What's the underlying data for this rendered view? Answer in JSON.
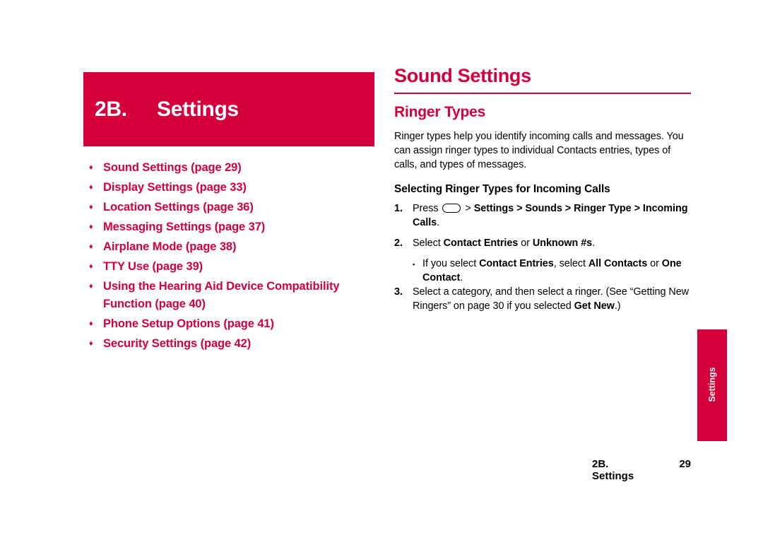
{
  "chapter": {
    "number": "2B.",
    "title": "Settings",
    "banner_color": "#d4003c"
  },
  "toc": {
    "bullet_glyph": "♦",
    "items": [
      {
        "label": "Sound Settings (page 29)"
      },
      {
        "label": "Display Settings (page 33)"
      },
      {
        "label": "Location Settings (page 36)"
      },
      {
        "label": "Messaging Settings (page 37)"
      },
      {
        "label": "Airplane Mode (page 38)"
      },
      {
        "label": "TTY Use (page 39)"
      },
      {
        "label": "Using the Hearing Aid Device Compatibility Function (page 40)"
      },
      {
        "label": "Phone Setup Options (page 41)"
      },
      {
        "label": "Security Settings (page 42)"
      }
    ]
  },
  "main": {
    "section_title": "Sound Settings",
    "subsection_title": "Ringer Types",
    "intro": "Ringer types help you identify incoming calls and messages. You can assign ringer types to individual Contacts entries, types of calls, and types of messages.",
    "procedure_title": "Selecting Ringer Types for Incoming Calls",
    "steps": [
      {
        "num": "1.",
        "parts": [
          {
            "text": "Press ",
            "bold": false
          },
          {
            "text": "key-icon",
            "icon": true
          },
          {
            "text": " > ",
            "bold": false
          },
          {
            "text": "Settings > Sounds > Ringer Type > Incoming Calls",
            "bold": true
          },
          {
            "text": ".",
            "bold": false
          }
        ]
      },
      {
        "num": "2.",
        "parts": [
          {
            "text": "Select ",
            "bold": false
          },
          {
            "text": "Contact Entries",
            "bold": true
          },
          {
            "text": " or ",
            "bold": false
          },
          {
            "text": "Unknown #s",
            "bold": true
          },
          {
            "text": ".",
            "bold": false
          }
        ],
        "subbullet": {
          "glyph": "▪",
          "parts": [
            {
              "text": "If you select ",
              "bold": false
            },
            {
              "text": "Contact Entries",
              "bold": true
            },
            {
              "text": ", select ",
              "bold": false
            },
            {
              "text": "All Contacts",
              "bold": true
            },
            {
              "text": " or ",
              "bold": false
            },
            {
              "text": "One Contact",
              "bold": true
            },
            {
              "text": ".",
              "bold": false
            }
          ]
        }
      },
      {
        "num": "3.",
        "parts": [
          {
            "text": "Select a category, and then select a ringer. (See “Getting New Ringers” on page 30 if you selected ",
            "bold": false
          },
          {
            "text": "Get New",
            "bold": true
          },
          {
            "text": ".)",
            "bold": false
          }
        ]
      }
    ]
  },
  "side_tab": {
    "label": "Settings",
    "color": "#d4003c"
  },
  "footer": {
    "left": "2B. Settings",
    "page": "29"
  }
}
